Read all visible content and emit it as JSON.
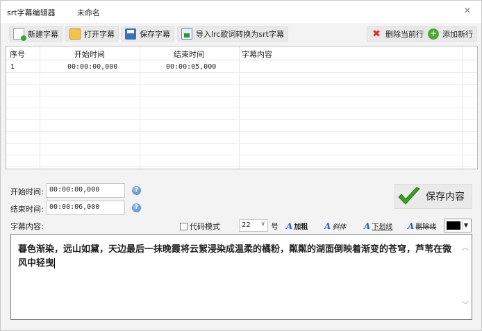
{
  "window": {
    "app_title": "srt字幕编辑器",
    "doc_title": "未命名",
    "close_glyph": "×"
  },
  "toolbar": {
    "new_label": "新建字幕",
    "open_label": "打开字幕",
    "save_label": "保存字幕",
    "import_label": "导入lrc歌词转换为srt字幕",
    "delete_row_label": "删除当前行",
    "add_row_label": "添加新行",
    "icons": {
      "new": "new-file-icon",
      "open": "folder-icon",
      "save": "floppy-disk-icon",
      "import": "import-icon",
      "delete": "delete-x-icon",
      "add": "add-circle-icon"
    },
    "delete_glyph": "✖",
    "add_glyph": "+"
  },
  "grid": {
    "columns": [
      "序号",
      "开始时间",
      "结束时间",
      "字幕内容"
    ],
    "rows": [
      {
        "index": "1",
        "start": "00:00:00,000",
        "end": "00:00:05,000",
        "content": ""
      }
    ]
  },
  "form": {
    "start_label": "开始时间:",
    "start_value": "00:00:00,000",
    "end_label": "结束时间:",
    "end_value": "00:00:06,000",
    "content_label": "字幕内容:",
    "save_content_label": "保存内容",
    "info_glyph": "?"
  },
  "format": {
    "code_mode_label": "代码模式",
    "font_size": "22",
    "size_unit": "号",
    "bold_label": "加粗",
    "italic_label": "斜体",
    "underline_label": "下划线",
    "strike_label": "删除线",
    "color": "#000000",
    "font_glyph": "A",
    "arrow_glyph": "∨",
    "color_arrow_glyph": "▼"
  },
  "editor": {
    "text": "暮色渐染，远山如黛，天边最后一抹晚霞将云絮浸染成温柔的橘粉，粼粼的湖面倒映着渐变的苍穹，芦苇在微风中轻曳",
    "scroll_up": "︿",
    "scroll_down": "﹀"
  },
  "colors": {
    "accent_blue": "#2b63c4",
    "delete_red": "#e02b2b",
    "add_green": "#53a53a",
    "check_green": "#3aa01f"
  }
}
